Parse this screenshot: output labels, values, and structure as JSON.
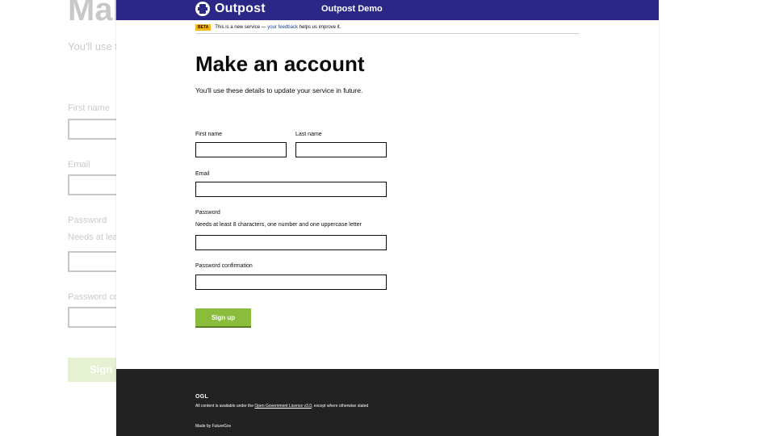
{
  "background": {
    "title": "Mak",
    "intro": "You'll use t",
    "first_name_label": "First name",
    "email_label": "Email",
    "password_label": "Password",
    "password_hint": "Needs at lea",
    "password_confirm_label": "Password co",
    "button_label": "Sign"
  },
  "header": {
    "logo_text": "Outpost",
    "service_name": "Outpost Demo"
  },
  "phase_banner": {
    "tag": "BETA",
    "text_before": "This is a new service —",
    "link_text": "your feedback",
    "text_after": "helps us improve it."
  },
  "main": {
    "title": "Make an account",
    "intro": "You'll use these details to update your service in future."
  },
  "form": {
    "first_name": {
      "label": "First name",
      "value": ""
    },
    "last_name": {
      "label": "Last name",
      "value": ""
    },
    "email": {
      "label": "Email",
      "value": ""
    },
    "password": {
      "label": "Password",
      "hint": "Needs at least 8 characters, one number and one uppercase letter",
      "value": ""
    },
    "password_confirmation": {
      "label": "Password confirmation",
      "value": ""
    },
    "submit_label": "Sign up"
  },
  "footer": {
    "ogl": "OGL",
    "licence_before": "All content is available under the",
    "licence_link": "Open Government Licence v3.0",
    "licence_after": ", except where otherwise stated",
    "made_by": "Made by FutureGov"
  },
  "colors": {
    "header_bg": "#2b2787",
    "button_bg": "#8bbd3c",
    "phase_tag_bg": "#f5b619",
    "footer_bg": "#222222"
  },
  "icons": {
    "logo": "outpost-logo-icon"
  }
}
